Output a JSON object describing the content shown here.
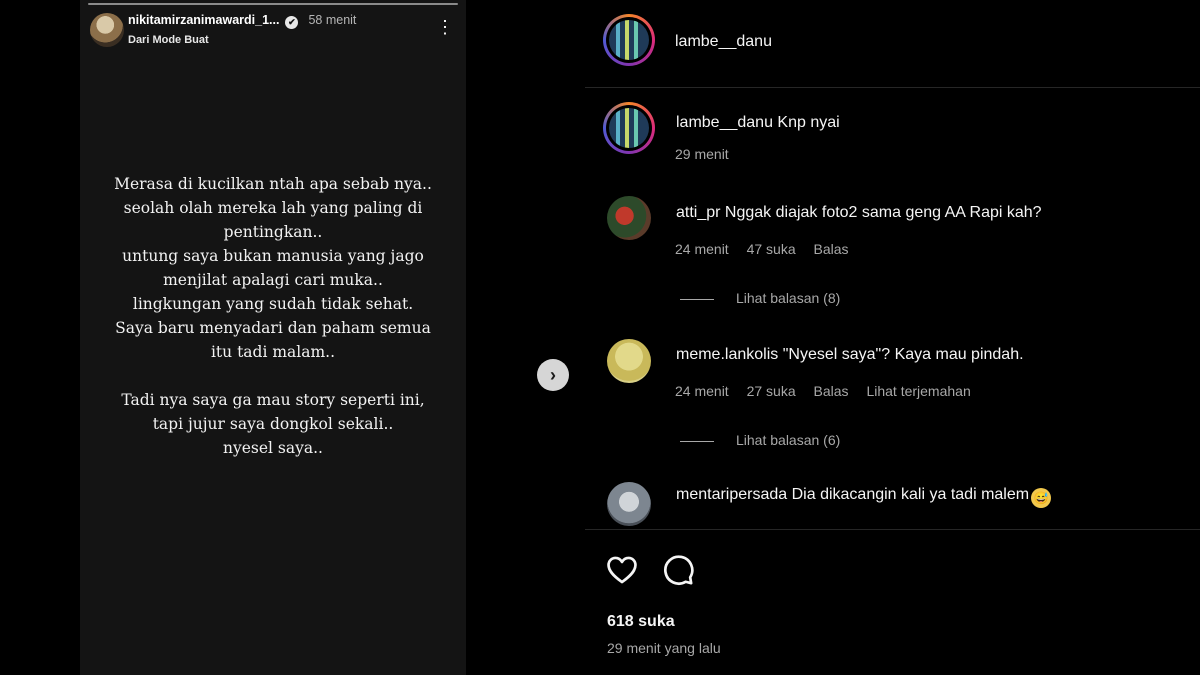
{
  "story": {
    "username": "nikitamirzanimawardi_1...",
    "time": "58 menit",
    "subtitle": "Dari Mode Buat",
    "more_icon": "⋮",
    "text": "Merasa di kucilkan ntah apa sebab nya..\nseolah olah mereka lah yang paling di\npentingkan..\nuntung saya bukan manusia yang jago\nmenjilat apalagi cari muka..\nlingkungan yang sudah tidak sehat.\nSaya baru menyadari dan paham semua\nitu tadi malam..\n\nTadi nya saya ga mau story seperti ini,\ntapi jujur saya dongkol sekali..\nnyesel saya.."
  },
  "next_button": "›",
  "post": {
    "author": "lambe__danu",
    "caption": {
      "username": "lambe__danu",
      "text": "Knp nyai",
      "time": "29 menit"
    },
    "comments": [
      {
        "username": "atti_pr",
        "text": "Nggak diajak foto2 sama geng AA Rapi kah?",
        "time": "24 menit",
        "likes": "47 suka",
        "reply": "Balas",
        "view_replies": "Lihat balasan (8)"
      },
      {
        "username": "meme.lankolis",
        "text": "\"Nyesel saya\"? Kaya mau pindah.",
        "time": "24 menit",
        "likes": "27 suka",
        "reply": "Balas",
        "translate": "Lihat terjemahan",
        "view_replies": "Lihat balasan (6)"
      },
      {
        "username": "mentaripersada",
        "text": "Dia dikacangin kali ya tadi malem",
        "emoji": "😅"
      }
    ],
    "likes": "618 suka",
    "posted": "29 menit yang lalu"
  },
  "icons": {
    "like": "heart-icon",
    "comment": "comment-icon"
  },
  "colors": {
    "background": "#000000",
    "story_bg": "#141414",
    "muted_text": "#a8a8a8"
  }
}
